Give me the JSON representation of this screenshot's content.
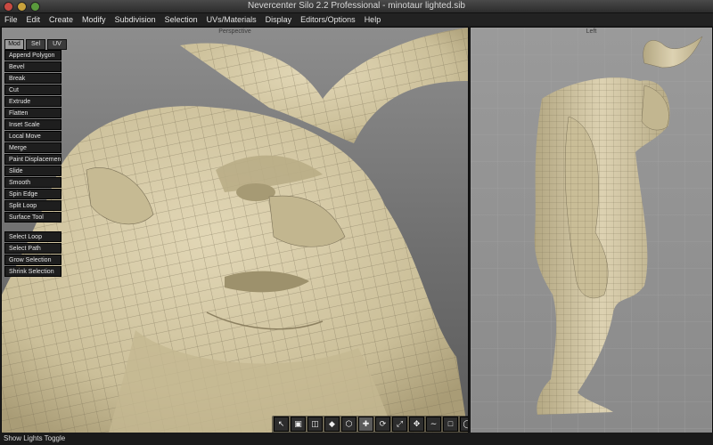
{
  "window": {
    "title": "Nevercenter Silo 2.2 Professional - minotaur lighted.sib"
  },
  "menu": [
    "File",
    "Edit",
    "Create",
    "Modify",
    "Subdivision",
    "Selection",
    "UVs/Materials",
    "Display",
    "Editors/Options",
    "Help"
  ],
  "viewports": {
    "perspective": "Perspective",
    "left": "Left"
  },
  "tabs": [
    "Mod",
    "Sel",
    "UV"
  ],
  "tools": [
    "Append Polygon",
    "Bevel",
    "Break",
    "Cut",
    "Extrude",
    "Flatten",
    "Inset Scale",
    "Local Move",
    "Merge",
    "Paint Displacement",
    "Slide",
    "Smooth",
    "Spin Edge",
    "Split Loop",
    "Surface Tool"
  ],
  "selection_tools": [
    "Select Loop",
    "Select Path",
    "Grow Selection",
    "Shrink Selection"
  ],
  "bottom_toolbar": [
    "select-arrow",
    "cube-face",
    "cube-edge",
    "cube-vertex",
    "cube-object",
    "move-widget",
    "rotate-widget",
    "scale-widget",
    "universal-widget",
    "curve-tool",
    "marquee-select",
    "lasso-select"
  ],
  "status": "Show Lights Toggle",
  "colors": {
    "mesh": "#d6caa6",
    "wire": "#7c7258"
  }
}
